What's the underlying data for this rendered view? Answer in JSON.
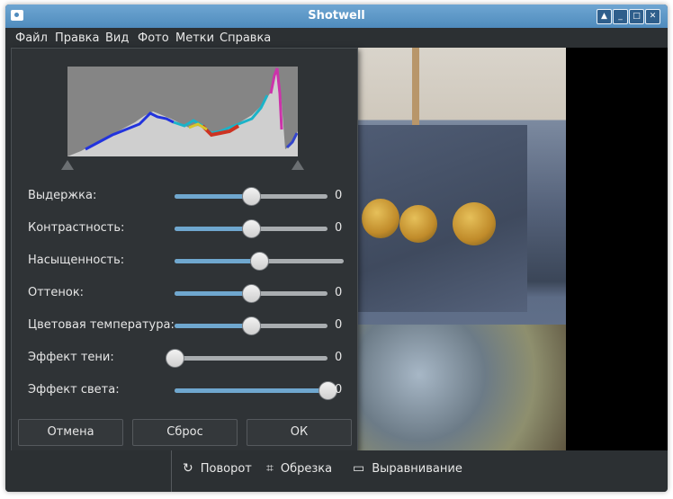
{
  "window": {
    "title": "Shotwell"
  },
  "menu": [
    "Файл",
    "Правка",
    "Вид",
    "Фото",
    "Метки",
    "Справка"
  ],
  "adjust": {
    "rows": [
      {
        "label": "Выдержка:",
        "value": "0",
        "level": 0.5,
        "show_value": true
      },
      {
        "label": "Контрастность:",
        "value": "0",
        "level": 0.5,
        "show_value": true
      },
      {
        "label": "Насыщенность:",
        "value": "",
        "level": 0.5,
        "show_value": false
      },
      {
        "label": "Оттенок:",
        "value": "0",
        "level": 0.5,
        "show_value": true
      },
      {
        "label": "Цветовая температура:",
        "value": "0",
        "level": 0.5,
        "show_value": true
      },
      {
        "label": "Эффект тени:",
        "value": "0",
        "level": 0.0,
        "show_value": true
      },
      {
        "label": "Эффект света:",
        "value": "0",
        "level": 1.0,
        "show_value": true
      }
    ],
    "buttons": {
      "cancel": "Отмена",
      "reset": "Сброс",
      "ok": "ОК"
    }
  },
  "toolbar": {
    "rotate": "Поворот",
    "crop": "Обрезка",
    "straighten": "Выравнивание"
  },
  "icons": {
    "rotate": "rotate-icon",
    "crop": "crop-icon",
    "straighten": "ruler-icon"
  },
  "colors": {
    "accent": "#6fa7cf",
    "titlebar": "#5a95c6",
    "background": "#2c3033"
  }
}
